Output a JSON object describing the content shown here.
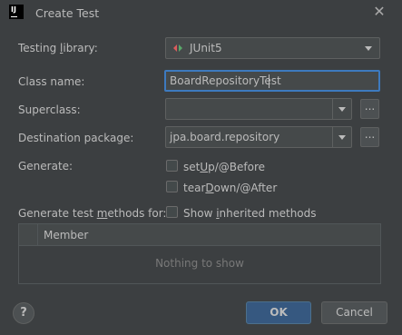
{
  "window": {
    "app_icon_text": "IJ",
    "title": "Create Test",
    "close_glyph": "✕"
  },
  "form": {
    "testing_library": {
      "label_pre": "Testing ",
      "label_mn": "l",
      "label_post": "ibrary:",
      "value": "JUnit5",
      "icon": "junit-icon"
    },
    "class_name": {
      "label": "Class name:",
      "value": "BoardRepositoryTest"
    },
    "superclass": {
      "label": "Superclass:",
      "value": "",
      "browse_label": "..."
    },
    "destination_package": {
      "label": "Destination package:",
      "value": "jpa.board.repository",
      "browse_label": "..."
    },
    "generate": {
      "label": "Generate:",
      "setup": {
        "pre": "set",
        "mn": "U",
        "post": "p/@Before",
        "checked": false
      },
      "teardown": {
        "pre": "tear",
        "mn": "D",
        "post": "own/@After",
        "checked": false
      }
    },
    "generate_methods": {
      "label_pre": "Generate test ",
      "label_mn": "m",
      "label_post": "ethods for:",
      "show_inherited": {
        "pre": "Show ",
        "mn": "i",
        "post": "nherited methods",
        "checked": false
      }
    }
  },
  "table": {
    "columns": [
      "Member"
    ],
    "empty_text": "Nothing to show"
  },
  "footer": {
    "help_glyph": "?",
    "ok_label": "OK",
    "cancel_label": "Cancel"
  },
  "colors": {
    "background": "#3c3f41",
    "field": "#45494a",
    "focus_border": "#3d7abf",
    "ok_button": "#365880",
    "junit_green": "#59a869",
    "junit_red": "#db5c5c"
  }
}
